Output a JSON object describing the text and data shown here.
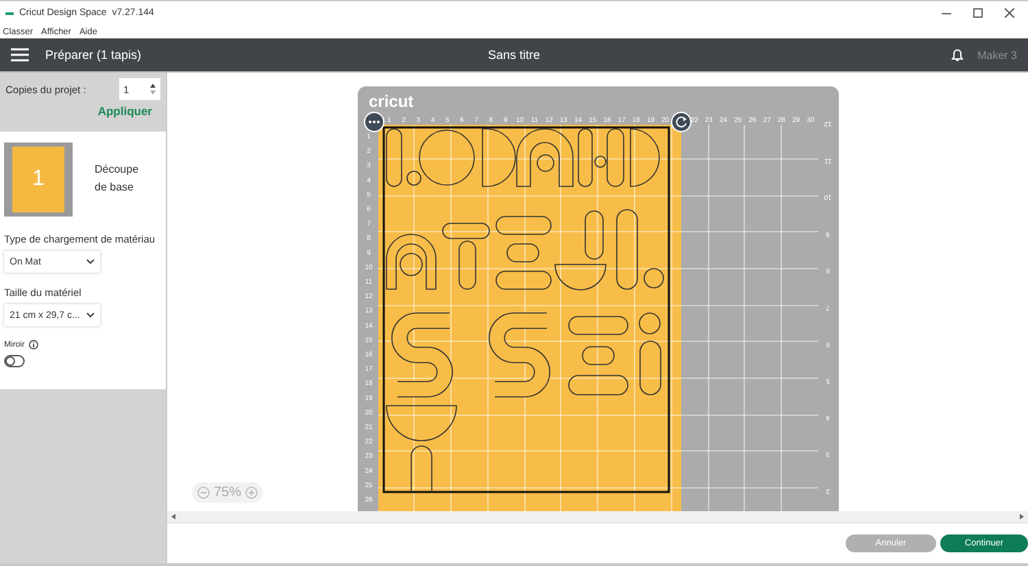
{
  "window": {
    "title": "Cricut Design Space  v7.27.144"
  },
  "menu": [
    "Classer",
    "Afficher",
    "Aide"
  ],
  "header": {
    "title": "Préparer (1 tapis)",
    "document": "Sans titre",
    "machine": "Maker 3"
  },
  "project": {
    "copies_label": "Copies du projet :",
    "copies": "1",
    "apply": "Appliquer"
  },
  "mats": [
    {
      "number": "1",
      "name": "Découpe de base"
    }
  ],
  "material_load": {
    "label": "Type de chargement de matériau",
    "value": "On Mat"
  },
  "material_size": {
    "label": "Taille du matériel",
    "value": "21 cm x 29,7 c..."
  },
  "mirror": {
    "label": "Miroir",
    "on": false
  },
  "mat": {
    "brand": "cricut",
    "top_ruler": [
      "1",
      "2",
      "3",
      "4",
      "5",
      "6",
      "7",
      "8",
      "9",
      "10",
      "11",
      "12",
      "13",
      "14",
      "15",
      "16",
      "17",
      "18",
      "19",
      "20",
      "22",
      "23",
      "24",
      "25",
      "26",
      "27",
      "28",
      "29",
      "30"
    ],
    "left_ruler": [
      "1",
      "2",
      "3",
      "4",
      "5",
      "6",
      "7",
      "8",
      "9",
      "10",
      "11",
      "12",
      "13",
      "14",
      "15",
      "16",
      "17",
      "18",
      "19",
      "20",
      "21",
      "22",
      "23",
      "24",
      "25",
      "26"
    ],
    "right_ruler": [
      "12",
      "11",
      "10",
      "9",
      "8",
      "7",
      "6",
      "5",
      "4",
      "3",
      "2"
    ]
  },
  "zoom": {
    "value": "75%"
  },
  "buttons": [
    {
      "label": "Annuler",
      "kind": "secondary"
    },
    {
      "label": "Continuer",
      "kind": "primary"
    }
  ]
}
